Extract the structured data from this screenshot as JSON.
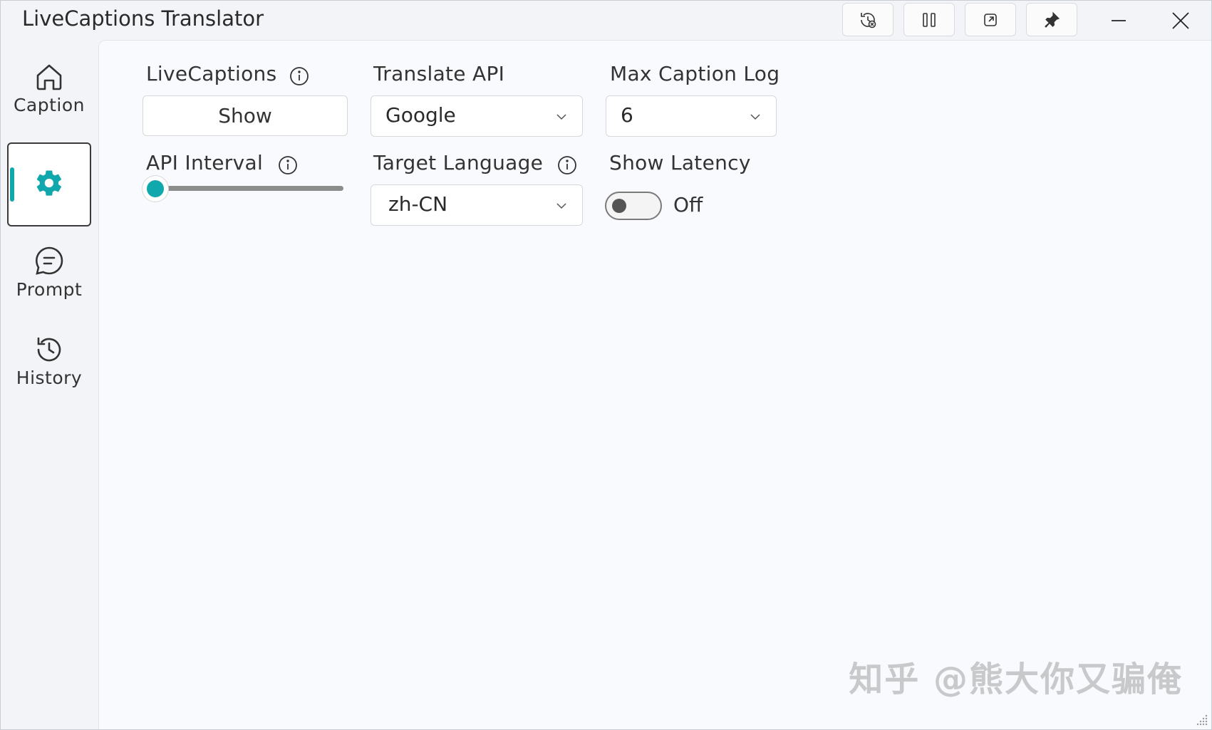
{
  "window": {
    "title": "LiveCaptions Translator",
    "toolbar": [
      {
        "name": "log-only-toggle",
        "icon": "history-clear-icon"
      },
      {
        "name": "pause-button",
        "icon": "pause-icon"
      },
      {
        "name": "overlay-window-button",
        "icon": "external-window-icon"
      },
      {
        "name": "pin-button",
        "icon": "pin-icon"
      }
    ],
    "controls": [
      "minimize",
      "close"
    ]
  },
  "sidebar": {
    "items": [
      {
        "label": "Caption",
        "icon": "home-icon",
        "active": false
      },
      {
        "label": "",
        "icon": "gear-icon",
        "active": true
      },
      {
        "label": "Prompt",
        "icon": "chat-icon",
        "active": false
      },
      {
        "label": "History",
        "icon": "history-icon",
        "active": false
      }
    ]
  },
  "settings": {
    "livecaptions": {
      "label": "LiveCaptions",
      "button": "Show"
    },
    "translate_api": {
      "label": "Translate API",
      "value": "Google"
    },
    "max_caption_log": {
      "label": "Max Caption Log",
      "value": "6"
    },
    "api_interval": {
      "label": "API Interval",
      "level": 0.0
    },
    "target_language": {
      "label": "Target Language",
      "value": "zh-CN"
    },
    "show_latency": {
      "label": "Show Latency",
      "state": "Off"
    }
  },
  "watermark": "知乎 @熊大你又骗俺",
  "colors": {
    "accent": "#10a7ad",
    "window_bg": "#f3f4f8",
    "content_bg": "#f9fafd"
  }
}
